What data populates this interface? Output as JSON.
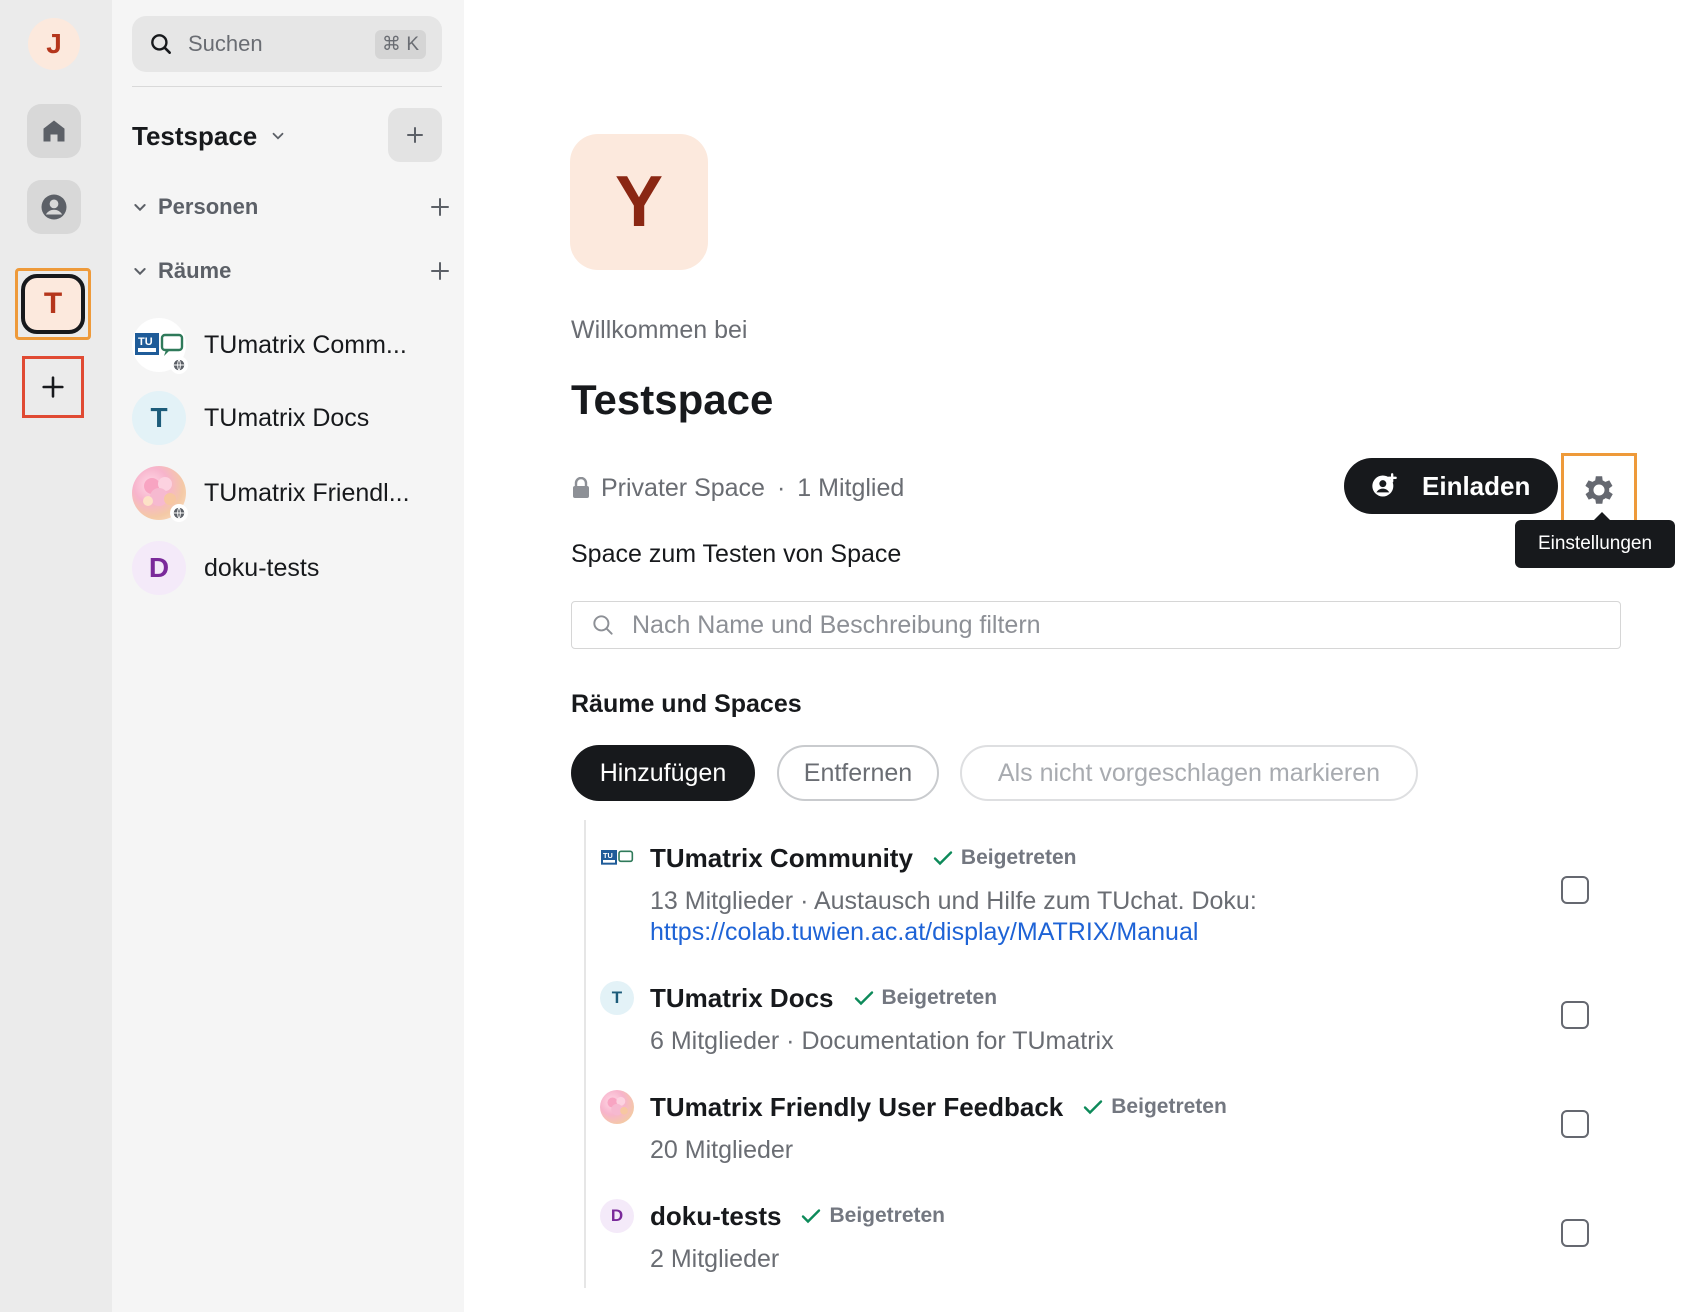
{
  "user": {
    "initial": "J"
  },
  "rail": {
    "active_space_initial": "T"
  },
  "search": {
    "label": "Suchen",
    "shortcut": "⌘ K"
  },
  "roomlist": {
    "space_name": "Testspace",
    "sections": [
      {
        "label": "Personen"
      },
      {
        "label": "Räume"
      }
    ],
    "rooms": [
      {
        "name": "TUmatrix Comm...",
        "avatar": "TU"
      },
      {
        "name": "TUmatrix Docs",
        "avatar": "T"
      },
      {
        "name": "TUmatrix Friendl...",
        "avatar": ""
      },
      {
        "name": "doku-tests",
        "avatar": "D"
      }
    ]
  },
  "main": {
    "avatar_initial": "Y",
    "welcome": "Willkommen bei",
    "title": "Testspace",
    "privacy": "Privater Space",
    "separator": "·",
    "members": "1 Mitglied",
    "invite_label": "Einladen",
    "settings_tooltip": "Einstellungen",
    "description": "Space zum Testen von Space",
    "filter_placeholder": "Nach Name und Beschreibung filtern",
    "section_title": "Räume und Spaces",
    "actions": [
      "Hinzufügen",
      "Entfernen",
      "Als nicht vorgeschlagen markieren"
    ],
    "items": [
      {
        "name": "TUmatrix Community",
        "avatar": "TU",
        "status": "Beigetreten",
        "desc": "13 Mitglieder · Austausch und Hilfe zum TUchat. Doku:",
        "link": "https://colab.tuwien.ac.at/display/MATRIX/Manual"
      },
      {
        "name": "TUmatrix Docs",
        "avatar": "T",
        "status": "Beigetreten",
        "desc": "6 Mitglieder · Documentation for TUmatrix"
      },
      {
        "name": "TUmatrix Friendly User Feedback",
        "avatar": "",
        "status": "Beigetreten",
        "desc": "20 Mitglieder"
      },
      {
        "name": "doku-tests",
        "avatar": "D",
        "status": "Beigetreten",
        "desc": "2 Mitglieder"
      }
    ]
  },
  "colors": {
    "accent_dark": "#17191c",
    "avatar_bg": "#fce9dd",
    "highlight_orange": "#ee9a3a",
    "highlight_red": "#e04a33",
    "link": "#1e63d6",
    "joined_check": "#0d8a5a"
  }
}
